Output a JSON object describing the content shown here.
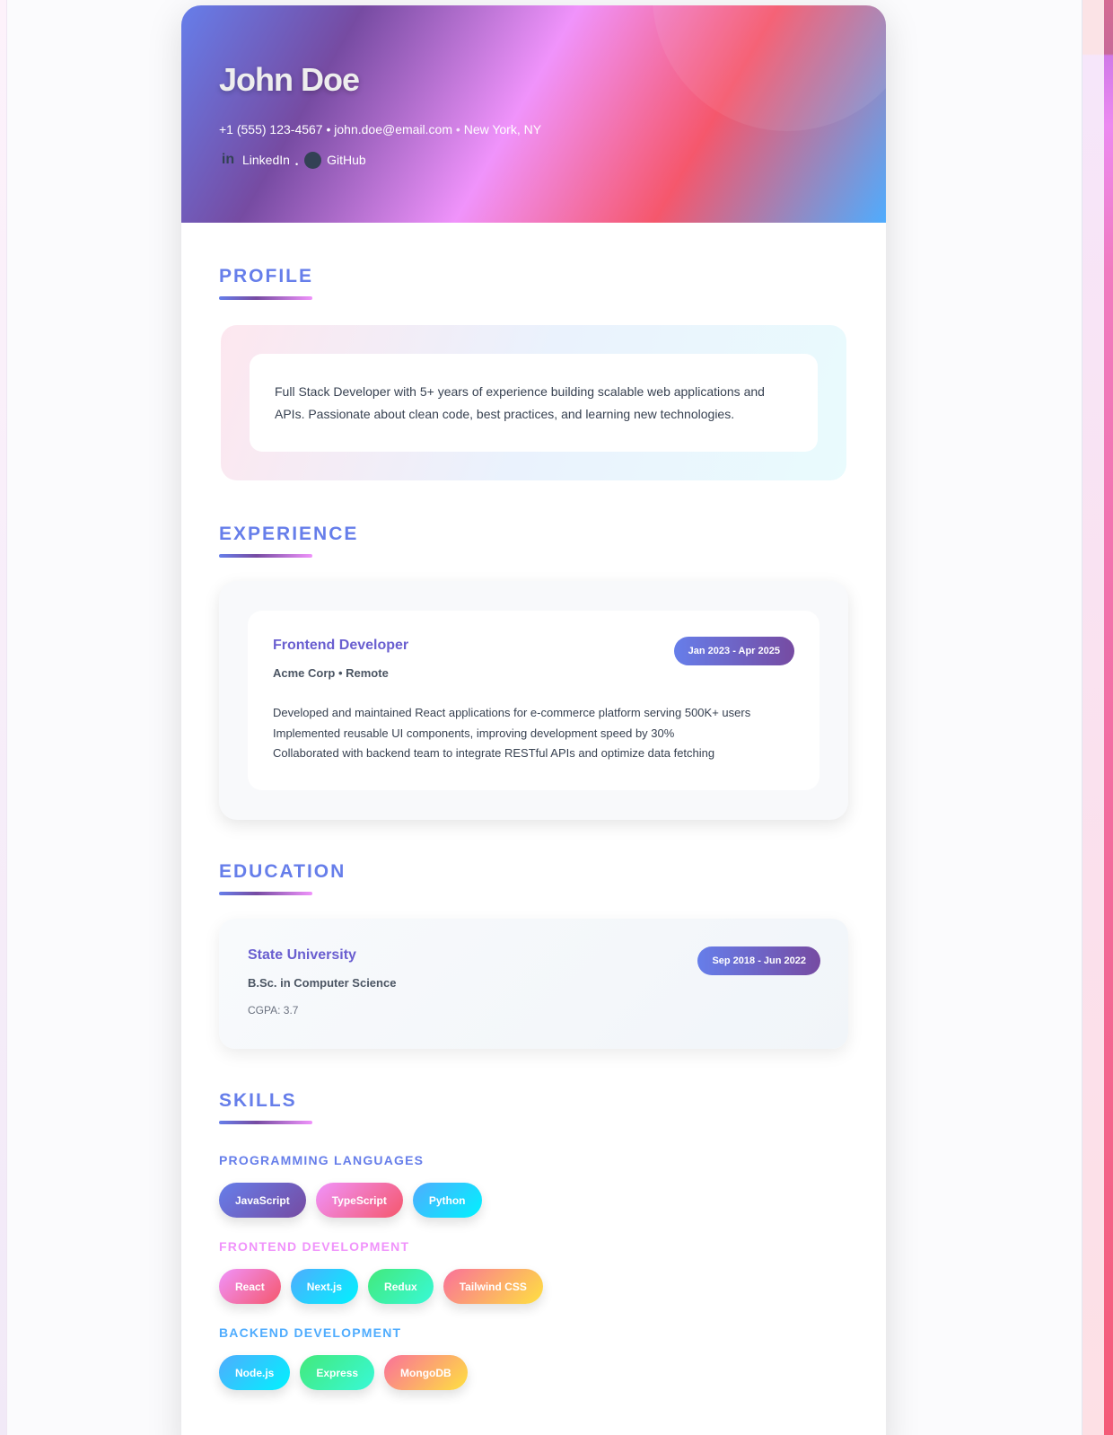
{
  "header": {
    "name": "John Doe",
    "phone": "+1 (555) 123-4567",
    "email": "john.doe@email.com",
    "location": "New York, NY",
    "separator": "•",
    "links": [
      {
        "label": "LinkedIn",
        "icon": "linkedin-icon"
      },
      {
        "label": "GitHub",
        "icon": "github-icon"
      }
    ],
    "link_separator": "•"
  },
  "sections": {
    "profile": "PROFILE",
    "experience": "EXPERIENCE",
    "education": "EDUCATION",
    "skills": "SKILLS"
  },
  "profile": "Full Stack Developer with 5+ years of experience building scalable web applications and APIs. Passionate about clean code, best practices, and learning new technologies.",
  "experience": [
    {
      "title": "Frontend Developer",
      "company": "Acme Corp • Remote",
      "dates": "Jan 2023 - Apr 2025",
      "bullets": [
        "Developed and maintained React applications for e-commerce platform serving 500K+ users",
        "Implemented reusable UI components, improving development speed by 30%",
        "Collaborated with backend team to integrate RESTful APIs and optimize data fetching"
      ]
    }
  ],
  "education": [
    {
      "school": "State University",
      "degree": "B.Sc. in Computer Science",
      "dates": "Sep 2018 - Jun 2022",
      "gpa": "CGPA: 3.7"
    }
  ],
  "skills": [
    {
      "category": "PROGRAMMING LANGUAGES",
      "color": "#667eea",
      "items": [
        "JavaScript",
        "TypeScript",
        "Python"
      ]
    },
    {
      "category": "FRONTEND DEVELOPMENT",
      "color": "#f093fb",
      "items": [
        "React",
        "Next.js",
        "Redux",
        "Tailwind CSS"
      ]
    },
    {
      "category": "BACKEND DEVELOPMENT",
      "color": "#4facfe",
      "items": [
        "Node.js",
        "Express",
        "MongoDB"
      ]
    }
  ]
}
